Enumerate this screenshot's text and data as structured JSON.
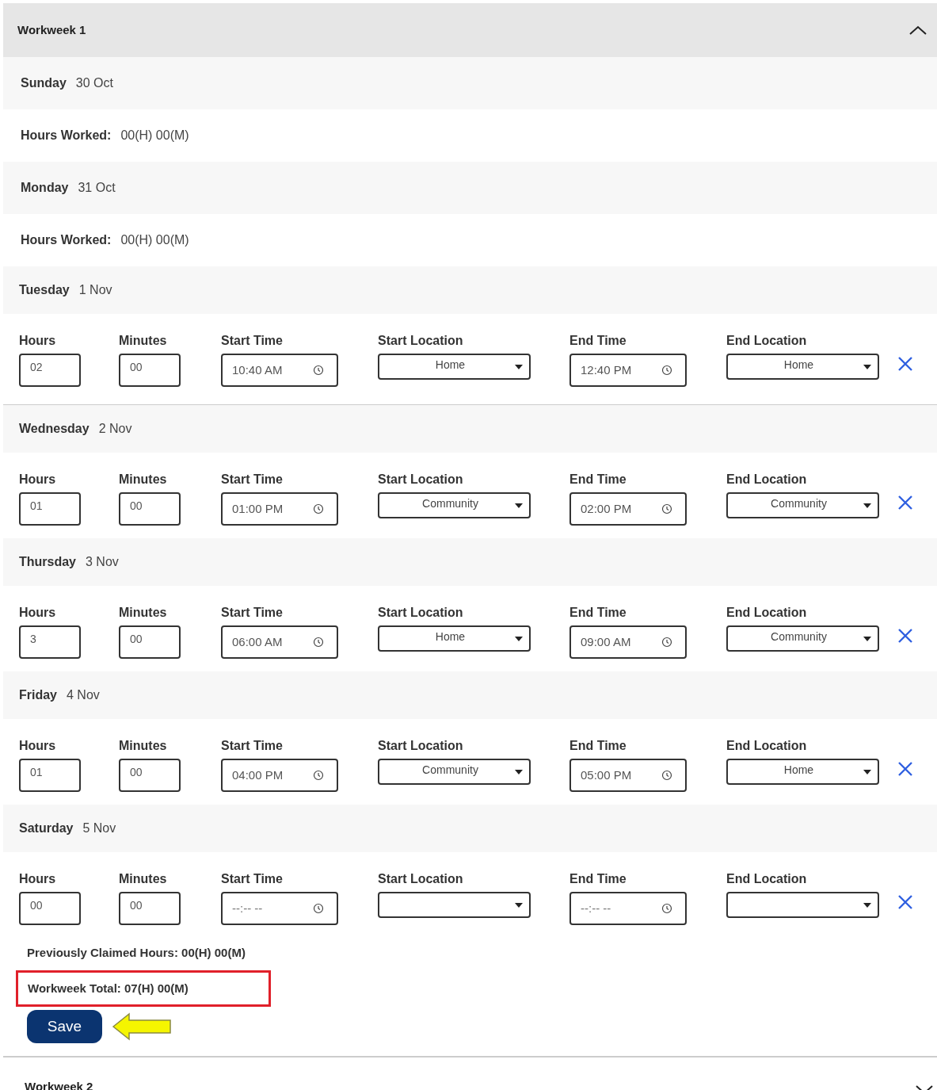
{
  "workweeks": [
    {
      "title": "Workweek 1",
      "expanded": true,
      "days": [
        {
          "kind": "summary",
          "day": "Sunday",
          "date": "30 Oct",
          "hours_label": "Hours Worked:",
          "hours_value": "00(H) 00(M)"
        },
        {
          "kind": "summary",
          "day": "Monday",
          "date": "31 Oct",
          "hours_label": "Hours Worked:",
          "hours_value": "00(H) 00(M)"
        },
        {
          "kind": "entry",
          "day": "Tuesday",
          "date": "1 Nov",
          "fields": [
            {
              "kind": "text",
              "label": "Hours",
              "value": "02"
            },
            {
              "kind": "text",
              "label": "Minutes",
              "value": "00"
            },
            {
              "kind": "time",
              "label": "Start Time",
              "value": "10:40 AM"
            },
            {
              "kind": "select",
              "label": "Start Location",
              "value": "Home"
            },
            {
              "kind": "time",
              "label": "End Time",
              "value": "12:40 PM"
            },
            {
              "kind": "select",
              "label": "End Location",
              "value": "Home"
            }
          ]
        },
        {
          "kind": "entry",
          "day": "Wednesday",
          "date": "2 Nov",
          "fields": [
            {
              "kind": "text",
              "label": "Hours",
              "value": "01"
            },
            {
              "kind": "text",
              "label": "Minutes",
              "value": "00"
            },
            {
              "kind": "time",
              "label": "Start Time",
              "value": "01:00 PM"
            },
            {
              "kind": "select",
              "label": "Start Location",
              "value": "Community"
            },
            {
              "kind": "time",
              "label": "End Time",
              "value": "02:00 PM"
            },
            {
              "kind": "select",
              "label": "End Location",
              "value": "Community"
            }
          ]
        },
        {
          "kind": "entry",
          "day": "Thursday",
          "date": "3 Nov",
          "fields": [
            {
              "kind": "text",
              "label": "Hours",
              "value": "3"
            },
            {
              "kind": "text",
              "label": "Minutes",
              "value": "00"
            },
            {
              "kind": "time",
              "label": "Start Time",
              "value": "06:00 AM"
            },
            {
              "kind": "select",
              "label": "Start Location",
              "value": "Home"
            },
            {
              "kind": "time",
              "label": "End Time",
              "value": "09:00 AM"
            },
            {
              "kind": "select",
              "label": "End Location",
              "value": "Community"
            }
          ]
        },
        {
          "kind": "entry",
          "day": "Friday",
          "date": "4 Nov",
          "fields": [
            {
              "kind": "text",
              "label": "Hours",
              "value": "01"
            },
            {
              "kind": "text",
              "label": "Minutes",
              "value": "00"
            },
            {
              "kind": "time",
              "label": "Start Time",
              "value": "04:00 PM"
            },
            {
              "kind": "select",
              "label": "Start Location",
              "value": "Community"
            },
            {
              "kind": "time",
              "label": "End Time",
              "value": "05:00 PM"
            },
            {
              "kind": "select",
              "label": "End Location",
              "value": "Home"
            }
          ]
        },
        {
          "kind": "entry",
          "day": "Saturday",
          "date": "5 Nov",
          "fields": [
            {
              "kind": "text",
              "label": "Hours",
              "value": "00"
            },
            {
              "kind": "text",
              "label": "Minutes",
              "value": "00"
            },
            {
              "kind": "time",
              "label": "Start Time",
              "placeholder": "--:-- --"
            },
            {
              "kind": "select",
              "label": "Start Location"
            },
            {
              "kind": "time",
              "label": "End Time",
              "placeholder": "--:-- --"
            },
            {
              "kind": "select",
              "label": "End Location"
            }
          ]
        }
      ],
      "previously_claimed": "Previously Claimed Hours: 00(H) 00(M)",
      "total": {
        "text": "Workweek Total: 07(H) 00(M)",
        "highlighted": true
      },
      "save_label": "Save"
    },
    {
      "title": "Workweek 2",
      "expanded": false
    }
  ]
}
